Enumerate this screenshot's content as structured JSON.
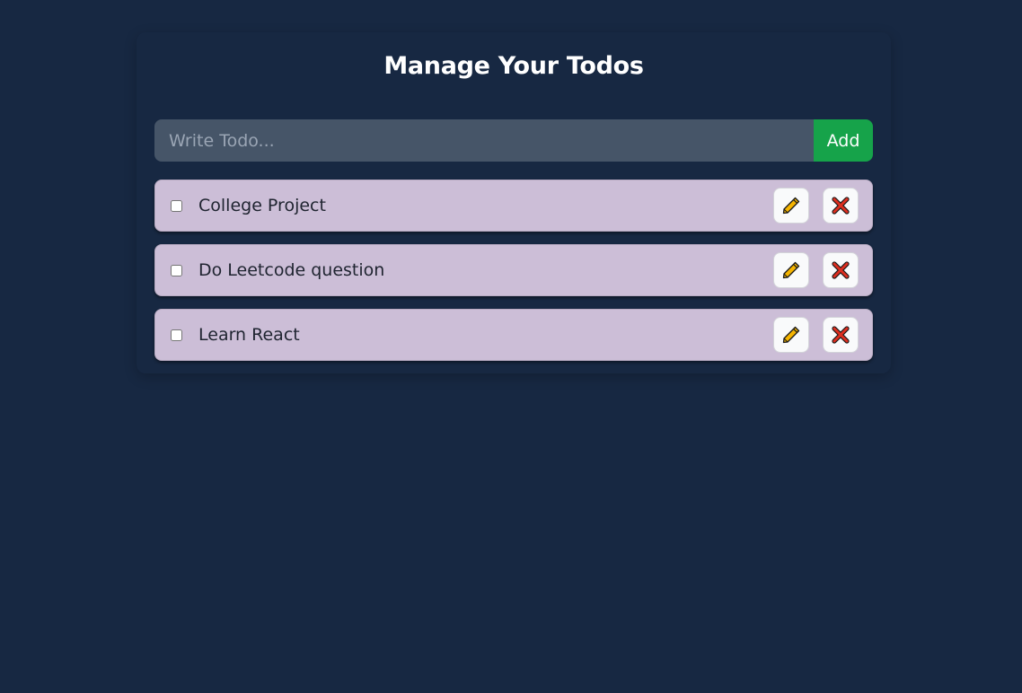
{
  "header": {
    "title": "Manage Your Todos"
  },
  "form": {
    "input_value": "",
    "placeholder": "Write Todo...",
    "add_label": "Add"
  },
  "todos": [
    {
      "text": "College Project",
      "completed": false
    },
    {
      "text": "Do Leetcode question",
      "completed": false
    },
    {
      "text": "Learn React",
      "completed": false
    }
  ],
  "icons": {
    "edit": "pencil-icon",
    "delete": "cross-mark-icon"
  },
  "colors": {
    "background": "#172842",
    "input": "#465568",
    "add_button": "#16a34a",
    "todo_item": "#ccbed7",
    "pencil": "#f5b400",
    "cross": "#dd2e1f"
  }
}
